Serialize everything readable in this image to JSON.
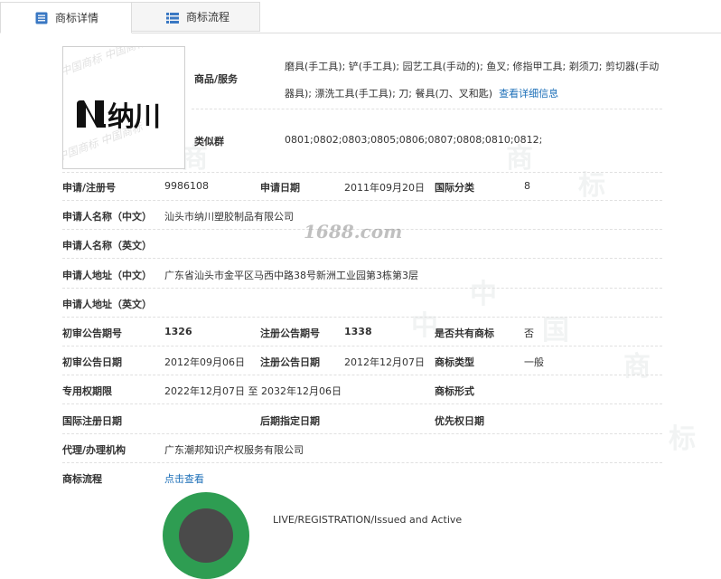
{
  "tabs": [
    {
      "label": "商标详情",
      "icon": "document-icon",
      "active": true
    },
    {
      "label": "商标流程",
      "icon": "list-icon",
      "active": false
    }
  ],
  "logo": {
    "text": "纳川",
    "alt_watermark": "中国商标"
  },
  "goods": {
    "label": "商品/服务",
    "text": "磨具(手工具); 铲(手工具); 园艺工具(手动的); 鱼叉; 修指甲工具; 剃须刀; 剪切器(手动器具); 漂洗工具(手工具); 刀; 餐具(刀、叉和匙)",
    "more_link": "查看详细信息"
  },
  "similar_group": {
    "label": "类似群",
    "value": "0801;0802;0803;0805;0806;0807;0808;0810;0812;"
  },
  "fields": {
    "reg_no_label": "申请/注册号",
    "reg_no": "9986108",
    "apply_date_label": "申请日期",
    "apply_date": "2011年09月20日",
    "intl_class_label": "国际分类",
    "intl_class": "8",
    "applicant_cn_label": "申请人名称（中文）",
    "applicant_cn": "汕头市纳川塑胶制品有限公司",
    "applicant_en_label": "申请人名称（英文）",
    "applicant_en": "",
    "address_cn_label": "申请人地址（中文）",
    "address_cn": "广东省汕头市金平区马西中路38号新洲工业园第3栋第3层",
    "address_en_label": "申请人地址（英文）",
    "address_en": "",
    "prelim_no_label": "初审公告期号",
    "prelim_no": "1326",
    "reg_pub_no_label": "注册公告期号",
    "reg_pub_no": "1338",
    "shared_label": "是否共有商标",
    "shared": "否",
    "prelim_date_label": "初审公告日期",
    "prelim_date": "2012年09月06日",
    "reg_pub_date_label": "注册公告日期",
    "reg_pub_date": "2012年12月07日",
    "mark_type_label": "商标类型",
    "mark_type": "一般",
    "exclusive_label": "专用权期限",
    "exclusive": "2022年12月07日 至 2032年12月06日",
    "mark_form_label": "商标形式",
    "mark_form": "",
    "intl_reg_label": "国际注册日期",
    "intl_reg": "",
    "later_label": "后期指定日期",
    "later": "",
    "priority_label": "优先权日期",
    "priority": "",
    "agent_label": "代理/办理机构",
    "agent": "广东潮邦知识产权服务有限公司",
    "flow_label": "商标流程",
    "flow_link": "点击查看"
  },
  "watermark_text": "1688.com",
  "status": {
    "text": "LIVE/REGISTRATION/Issued and Active",
    "color": "#2e9d52"
  }
}
